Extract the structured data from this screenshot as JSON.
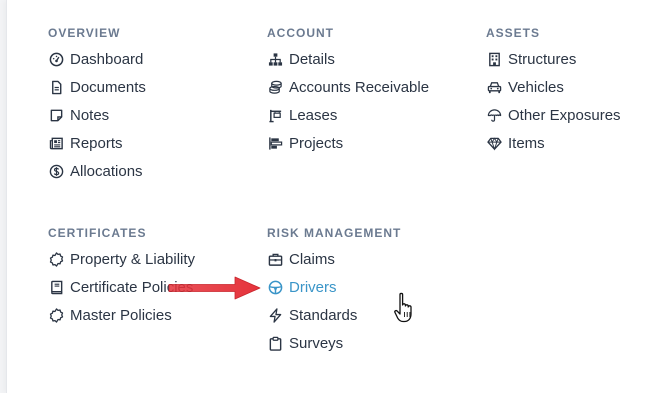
{
  "colors": {
    "text": "#2b3544",
    "heading": "#6b7a90",
    "active": "#3a95c8",
    "arrow": "#e5333b"
  },
  "overview": {
    "title": "OVERVIEW",
    "items": [
      {
        "label": "Dashboard",
        "icon": "dashboard-icon"
      },
      {
        "label": "Documents",
        "icon": "document-icon"
      },
      {
        "label": "Notes",
        "icon": "note-icon"
      },
      {
        "label": "Reports",
        "icon": "report-icon"
      },
      {
        "label": "Allocations",
        "icon": "dollar-circle-icon"
      }
    ]
  },
  "account": {
    "title": "ACCOUNT",
    "items": [
      {
        "label": "Details",
        "icon": "sitemap-icon"
      },
      {
        "label": "Accounts Receivable",
        "icon": "coins-icon"
      },
      {
        "label": "Leases",
        "icon": "lease-icon"
      },
      {
        "label": "Projects",
        "icon": "projects-icon"
      }
    ]
  },
  "assets": {
    "title": "ASSETS",
    "items": [
      {
        "label": "Structures",
        "icon": "building-icon"
      },
      {
        "label": "Vehicles",
        "icon": "car-icon"
      },
      {
        "label": "Other Exposures",
        "icon": "umbrella-icon"
      },
      {
        "label": "Items",
        "icon": "gem-icon"
      }
    ]
  },
  "certificates": {
    "title": "CERTIFICATES",
    "items": [
      {
        "label": "Property & Liability",
        "icon": "badge-icon"
      },
      {
        "label": "Certificate Policies",
        "icon": "book-icon"
      },
      {
        "label": "Master Policies",
        "icon": "badge-icon"
      }
    ]
  },
  "risk_management": {
    "title": "RISK MANAGEMENT",
    "items": [
      {
        "label": "Claims",
        "icon": "briefcase-icon"
      },
      {
        "label": "Drivers",
        "icon": "steering-wheel-icon",
        "active": true
      },
      {
        "label": "Standards",
        "icon": "bolt-icon"
      },
      {
        "label": "Surveys",
        "icon": "clipboard-icon"
      }
    ]
  }
}
